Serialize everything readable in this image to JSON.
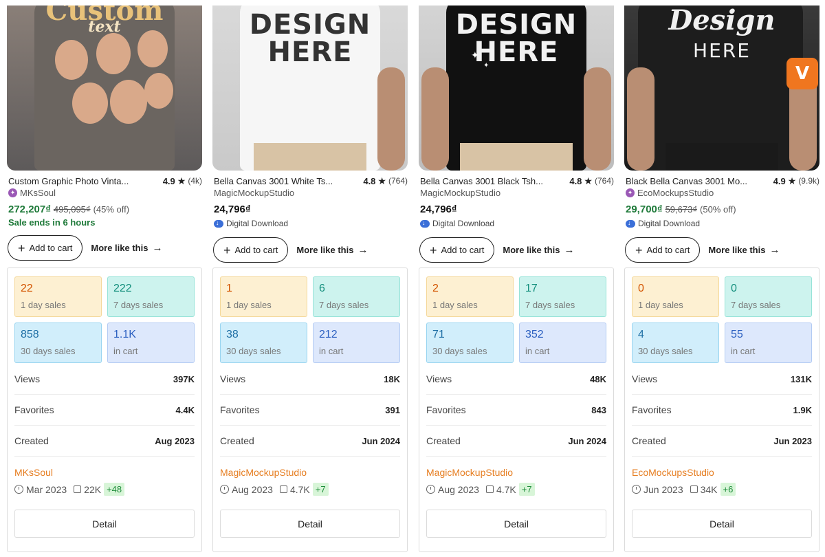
{
  "products": [
    {
      "image_text": [
        "Custom",
        "text"
      ],
      "title": "Custom Graphic Photo Vinta...",
      "rating": "4.9",
      "rating_count": "(4k)",
      "shop": "MKsSoul",
      "price": "272,207₫",
      "original_price": "495,095₫",
      "discount": "(45% off)",
      "sale_note": "Sale ends in 6 hours",
      "add_to_cart": "Add to cart",
      "more_like_this": "More like this",
      "stats": {
        "day1": "22",
        "day1_label": "1 day sales",
        "day7": "222",
        "day7_label": "7 days sales",
        "day30": "858",
        "day30_label": "30 days sales",
        "cart": "1.1K",
        "cart_label": "in cart"
      },
      "views_label": "Views",
      "views": "397K",
      "favorites_label": "Favorites",
      "favorites": "4.4K",
      "created_label": "Created",
      "created": "Aug 2023",
      "seller": "MKsSoul",
      "seller_since": "Mar 2023",
      "seller_sales": "22K",
      "seller_gain": "+48",
      "detail": "Detail"
    },
    {
      "image_text": [
        "DESIGN",
        "HERE"
      ],
      "title": "Bella Canvas 3001 White Ts...",
      "rating": "4.8",
      "rating_count": "(764)",
      "shop": "MagicMockupStudio",
      "price": "24,796₫",
      "digital": "Digital Download",
      "add_to_cart": "Add to cart",
      "more_like_this": "More like this",
      "stats": {
        "day1": "1",
        "day1_label": "1 day sales",
        "day7": "6",
        "day7_label": "7 days sales",
        "day30": "38",
        "day30_label": "30 days sales",
        "cart": "212",
        "cart_label": "in cart"
      },
      "views_label": "Views",
      "views": "18K",
      "favorites_label": "Favorites",
      "favorites": "391",
      "created_label": "Created",
      "created": "Jun 2024",
      "seller": "MagicMockupStudio",
      "seller_since": "Aug 2023",
      "seller_sales": "4.7K",
      "seller_gain": "+7",
      "detail": "Detail"
    },
    {
      "image_text": [
        "DESIGN",
        "HERE"
      ],
      "title": "Bella Canvas 3001 Black Tsh...",
      "rating": "4.8",
      "rating_count": "(764)",
      "shop": "MagicMockupStudio",
      "price": "24,796₫",
      "digital": "Digital Download",
      "add_to_cart": "Add to cart",
      "more_like_this": "More like this",
      "stats": {
        "day1": "2",
        "day1_label": "1 day sales",
        "day7": "17",
        "day7_label": "7 days sales",
        "day30": "71",
        "day30_label": "30 days sales",
        "cart": "352",
        "cart_label": "in cart"
      },
      "views_label": "Views",
      "views": "48K",
      "favorites_label": "Favorites",
      "favorites": "843",
      "created_label": "Created",
      "created": "Jun 2024",
      "seller": "MagicMockupStudio",
      "seller_since": "Aug 2023",
      "seller_sales": "4.7K",
      "seller_gain": "+7",
      "detail": "Detail"
    },
    {
      "image_text": [
        "Design",
        "HERE"
      ],
      "title": "Black Bella Canvas 3001 Mo...",
      "rating": "4.9",
      "rating_count": "(9.9k)",
      "shop": "EcoMockupsStudio",
      "price": "29,700₫",
      "original_price": "59,673₫",
      "discount": "(50% off)",
      "digital": "Digital Download",
      "add_to_cart": "Add to cart",
      "more_like_this": "More like this",
      "stats": {
        "day1": "0",
        "day1_label": "1 day sales",
        "day7": "0",
        "day7_label": "7 days sales",
        "day30": "4",
        "day30_label": "30 days sales",
        "cart": "55",
        "cart_label": "in cart"
      },
      "views_label": "Views",
      "views": "131K",
      "favorites_label": "Favorites",
      "favorites": "1.9K",
      "created_label": "Created",
      "created": "Jun 2023",
      "seller": "EcoMockupsStudio",
      "seller_since": "Jun 2023",
      "seller_sales": "34K",
      "seller_gain": "+6",
      "detail": "Detail"
    }
  ],
  "icons": {
    "rating": "star-icon",
    "shop_badge": "star-seller-icon",
    "digital": "cloud-download-icon",
    "add": "plus-icon",
    "more": "arrow-right-icon",
    "since": "clock-icon",
    "sales": "shopping-bag-icon"
  },
  "colors": {
    "sale_price": "#1f7a3a",
    "seller_link": "#e67e22",
    "gain": "#1e8c3a",
    "tile_orange": "#fdf0d2",
    "tile_teal": "#cdf3ee",
    "tile_cyan": "#d1eefb",
    "tile_blue": "#dde8fc"
  }
}
